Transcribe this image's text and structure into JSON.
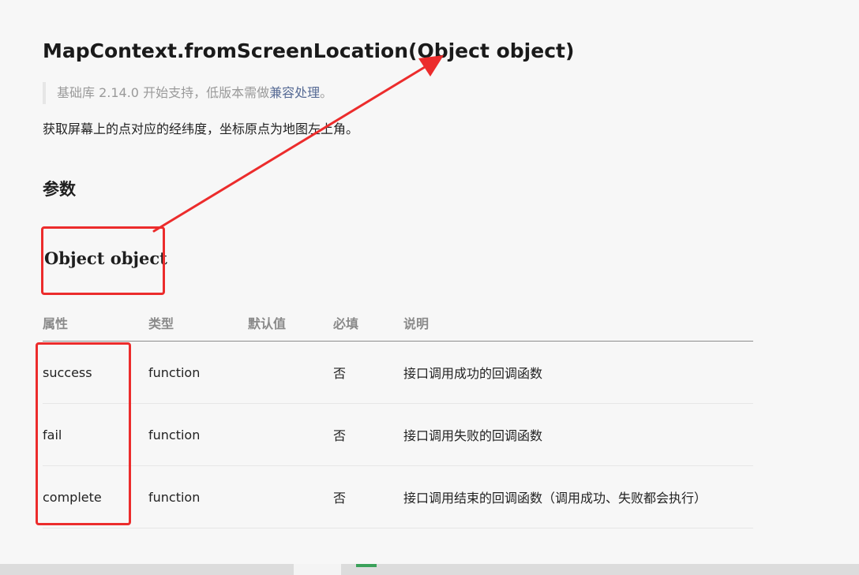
{
  "page": {
    "title": "MapContext.fromScreenLocation(Object object)",
    "support_prefix": "基础库 2.14.0 开始支持，低版本需做",
    "support_link": "兼容处理",
    "support_suffix": "。",
    "description": "获取屏幕上的点对应的经纬度，坐标原点为地图左上角。",
    "section_title": "参数",
    "param_title": "Object object"
  },
  "table": {
    "headers": [
      "属性",
      "类型",
      "默认值",
      "必填",
      "说明"
    ],
    "rows": [
      {
        "name": "success",
        "type": "function",
        "default": "",
        "required": "否",
        "desc": "接口调用成功的回调函数"
      },
      {
        "name": "fail",
        "type": "function",
        "default": "",
        "required": "否",
        "desc": "接口调用失败的回调函数"
      },
      {
        "name": "complete",
        "type": "function",
        "default": "",
        "required": "否",
        "desc": "接口调用结束的回调函数（调用成功、失败都会执行）"
      }
    ]
  },
  "colors": {
    "annotation": "#ec2c2c",
    "link": "#576b95",
    "muted": "#9a9a9a"
  }
}
